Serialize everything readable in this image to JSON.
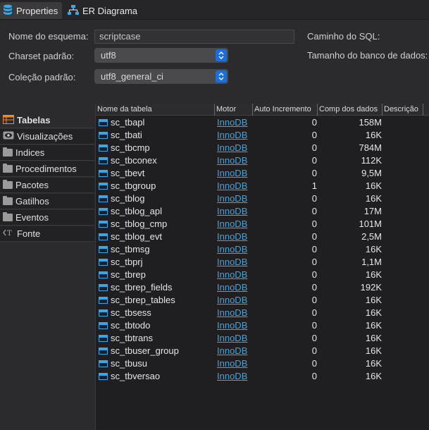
{
  "tabs": [
    {
      "label": "Properties",
      "active": true
    },
    {
      "label": "ER Diagrama",
      "active": false
    }
  ],
  "form": {
    "schema_name_label": "Nome do esquema:",
    "schema_name_value": "scriptcase",
    "charset_label": "Charset padrão:",
    "charset_value": "utf8",
    "collation_label": "Coleção padrão:",
    "collation_value": "utf8_general_ci",
    "sql_path_label": "Caminho do SQL:",
    "db_size_label": "Tamanho do banco de dados:"
  },
  "nav": {
    "items": [
      {
        "label": "Tabelas",
        "icon": "table-icon",
        "active": true
      },
      {
        "label": "Visualizações",
        "icon": "eye-icon",
        "active": false
      },
      {
        "label": "Indices",
        "icon": "folder-icon",
        "active": false
      },
      {
        "label": "Procedimentos",
        "icon": "folder-icon",
        "active": false
      },
      {
        "label": "Pacotes",
        "icon": "folder-icon",
        "active": false
      },
      {
        "label": "Gatilhos",
        "icon": "folder-icon",
        "active": false
      },
      {
        "label": "Eventos",
        "icon": "folder-icon",
        "active": false
      },
      {
        "label": "Fonte",
        "icon": "source-icon",
        "active": false
      }
    ]
  },
  "table": {
    "columns": [
      "Nome da tabela",
      "Motor",
      "Auto Incremento",
      "Comp dos dados",
      "Descrição"
    ],
    "rows": [
      {
        "name": "sc_tbapl",
        "engine": "InnoDB",
        "auto": "0",
        "size": "158M"
      },
      {
        "name": "sc_tbati",
        "engine": "InnoDB",
        "auto": "0",
        "size": "16K"
      },
      {
        "name": "sc_tbcmp",
        "engine": "InnoDB",
        "auto": "0",
        "size": "784M"
      },
      {
        "name": "sc_tbconex",
        "engine": "InnoDB",
        "auto": "0",
        "size": "112K"
      },
      {
        "name": "sc_tbevt",
        "engine": "InnoDB",
        "auto": "0",
        "size": "9,5M"
      },
      {
        "name": "sc_tbgroup",
        "engine": "InnoDB",
        "auto": "1",
        "size": "16K"
      },
      {
        "name": "sc_tblog",
        "engine": "InnoDB",
        "auto": "0",
        "size": "16K"
      },
      {
        "name": "sc_tblog_apl",
        "engine": "InnoDB",
        "auto": "0",
        "size": "17M"
      },
      {
        "name": "sc_tblog_cmp",
        "engine": "InnoDB",
        "auto": "0",
        "size": "101M"
      },
      {
        "name": "sc_tblog_evt",
        "engine": "InnoDB",
        "auto": "0",
        "size": "2,5M"
      },
      {
        "name": "sc_tbmsg",
        "engine": "InnoDB",
        "auto": "0",
        "size": "16K"
      },
      {
        "name": "sc_tbprj",
        "engine": "InnoDB",
        "auto": "0",
        "size": "1,1M"
      },
      {
        "name": "sc_tbrep",
        "engine": "InnoDB",
        "auto": "0",
        "size": "16K"
      },
      {
        "name": "sc_tbrep_fields",
        "engine": "InnoDB",
        "auto": "0",
        "size": "192K"
      },
      {
        "name": "sc_tbrep_tables",
        "engine": "InnoDB",
        "auto": "0",
        "size": "16K"
      },
      {
        "name": "sc_tbsess",
        "engine": "InnoDB",
        "auto": "0",
        "size": "16K"
      },
      {
        "name": "sc_tbtodo",
        "engine": "InnoDB",
        "auto": "0",
        "size": "16K"
      },
      {
        "name": "sc_tbtrans",
        "engine": "InnoDB",
        "auto": "0",
        "size": "16K"
      },
      {
        "name": "sc_tbuser_group",
        "engine": "InnoDB",
        "auto": "0",
        "size": "16K"
      },
      {
        "name": "sc_tbusu",
        "engine": "InnoDB",
        "auto": "0",
        "size": "16K"
      },
      {
        "name": "sc_tbversao",
        "engine": "InnoDB",
        "auto": "0",
        "size": "16K"
      }
    ]
  },
  "colors": {
    "accent": "#1a6fe0",
    "link": "#3aa7e8",
    "background": "#2b2b2d"
  }
}
